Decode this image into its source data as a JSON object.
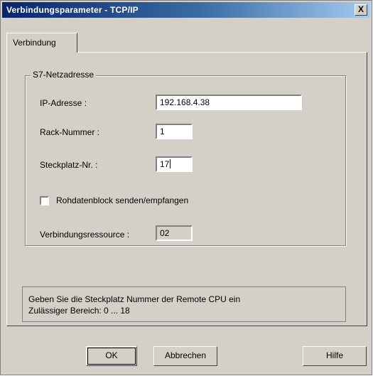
{
  "window": {
    "title": "Verbindungsparameter - TCP/IP",
    "close_label": "X"
  },
  "tabs": [
    {
      "label": "Verbindung",
      "active": true
    }
  ],
  "group": {
    "title": "S7-Netzadresse",
    "ip_label": "IP-Adresse :",
    "ip_value": "192.168.4.38",
    "rack_label": "Rack-Nummer :",
    "rack_value": "1",
    "slot_label": "Steckplatz-Nr. :",
    "slot_value": "17",
    "raw_checkbox_label": "Rohdatenblock senden/empfangen",
    "raw_checkbox_checked": false,
    "resource_label": "Verbindungsressource :",
    "resource_value": "02"
  },
  "info": {
    "line1": "Geben Sie die Steckplatz Nummer der Remote CPU ein",
    "line2": "Zulässiger Bereich: 0 ... 18"
  },
  "buttons": {
    "ok": "OK",
    "cancel": "Abbrechen",
    "help": "Hilfe"
  },
  "colors": {
    "window_bg": "#d4d0c8",
    "titlebar_start": "#0a246a",
    "titlebar_end": "#a6caf0"
  }
}
